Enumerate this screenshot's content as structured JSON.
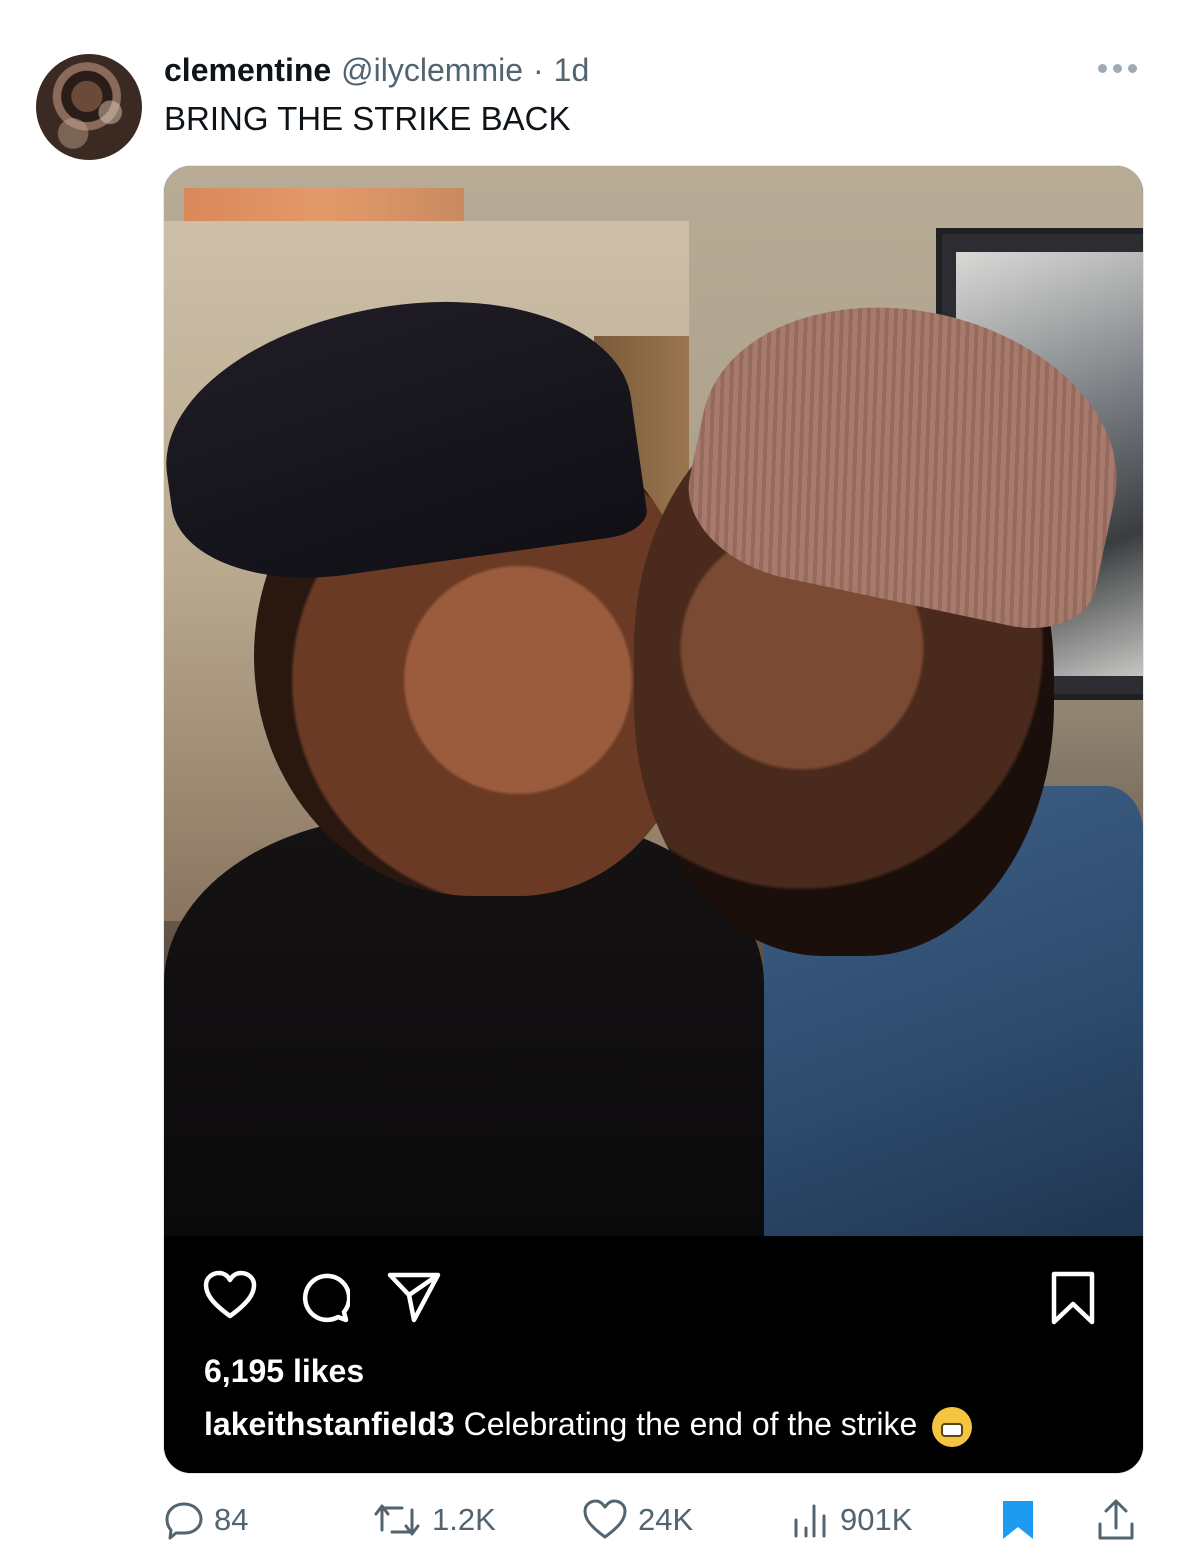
{
  "tweet": {
    "display_name": "clementine",
    "handle": "@ilyclemmie",
    "separator": "·",
    "time": "1d",
    "text": "BRING THE STRIKE BACK"
  },
  "instagram_post": {
    "likes": "6,195 likes",
    "caption_user": "lakeithstanfield3",
    "caption_text": "Celebrating the end of the strike"
  },
  "actions": {
    "replies": "84",
    "retweets": "1.2K",
    "likes": "24K",
    "views": "901K"
  },
  "colors": {
    "bookmark_active": "#1d9bf0",
    "muted": "#536471"
  }
}
